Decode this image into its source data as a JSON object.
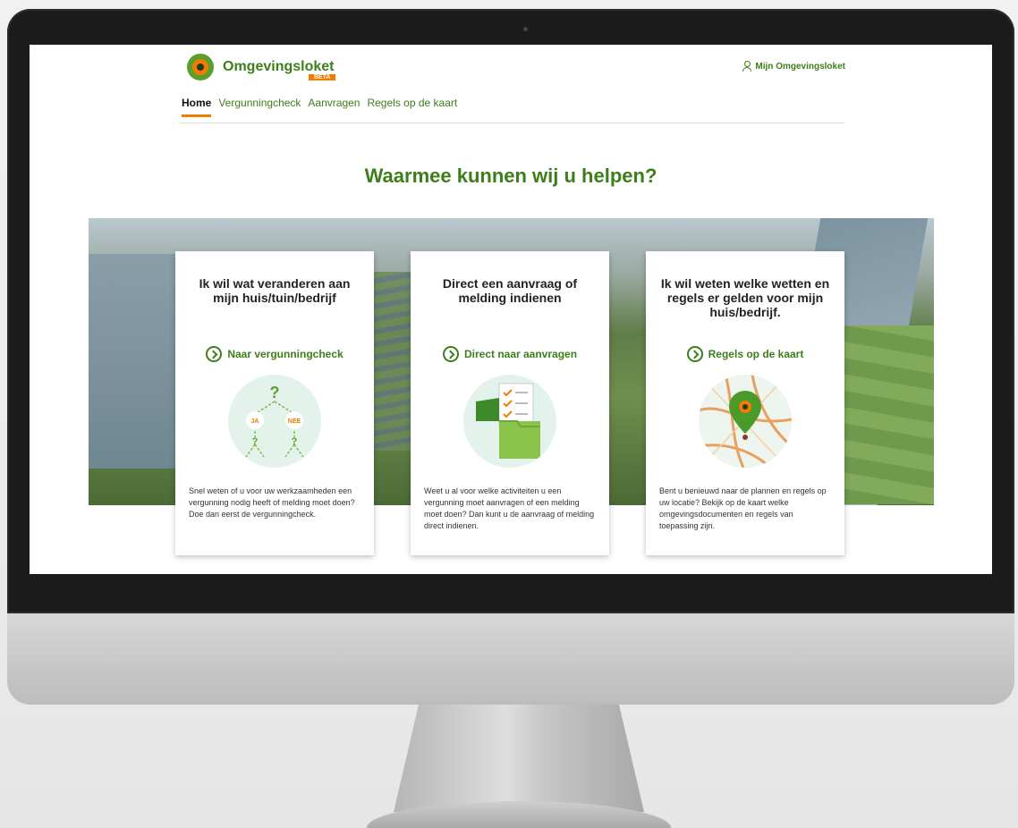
{
  "header": {
    "logo_text": "Omgevingsloket",
    "beta_label": "BETA",
    "user_link": "Mijn Omgevingsloket"
  },
  "nav": {
    "items": [
      "Home",
      "Vergunningcheck",
      "Aanvragen",
      "Regels op de kaart"
    ],
    "active": "Home"
  },
  "hero": {
    "title": "Waarmee kunnen wij u helpen?"
  },
  "cards": [
    {
      "title": "Ik wil wat veranderen aan mijn huis/tuin/bedrijf",
      "link": "Naar vergunningcheck",
      "illustration_labels": [
        "?",
        "JA",
        "NEE",
        "?",
        "?"
      ],
      "text": "Snel weten of u voor uw werkzaamheden een vergunning nodig heeft of melding moet doen? Doe dan eerst de vergunningcheck."
    },
    {
      "title": "Direct een aanvraag of melding indienen",
      "link": "Direct naar aanvragen",
      "text": "Weet u al voor welke activiteiten u een vergunning moet aanvragen of een melding moet doen? Dan kunt u de aanvraag of melding direct indienen."
    },
    {
      "title": "Ik wil weten welke wetten en regels er gelden voor mijn huis/bedrijf.",
      "link": "Regels op de kaart",
      "text": "Bent u benieuwd naar de plannen en regels op uw locatie? Bekijk op de kaart welke omgevingsdocumenten en regels van toepassing zijn."
    }
  ],
  "colors": {
    "brand_green": "#3e7e1a",
    "accent_orange": "#f07c00"
  }
}
